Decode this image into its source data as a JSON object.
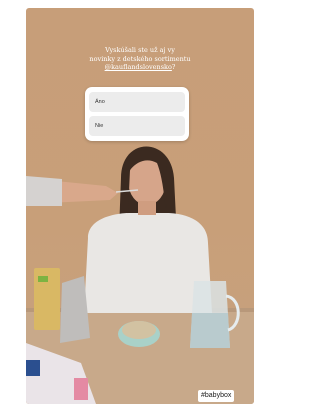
{
  "story": {
    "question_line1": "Vyskúšali ste už aj vy",
    "question_line2": "novinky z detského sortimentu",
    "question_mention": "@kauflandslovensko",
    "question_end": "?",
    "poll_options": [
      "Áno",
      "Nie"
    ],
    "hashtag": "#babybox"
  },
  "colors": {
    "background": "#c79e79",
    "poll_bg": "#ffffff",
    "option_bg": "#ececec"
  }
}
